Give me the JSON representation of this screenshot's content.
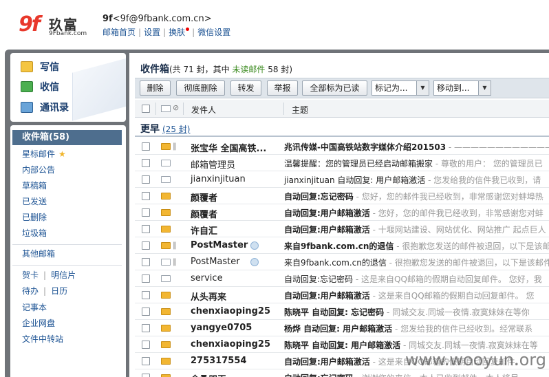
{
  "header": {
    "logo_mark": "9f",
    "logo_cn": "玖富",
    "logo_domain": "9Fbank.com",
    "user_name": "9f",
    "user_email": "<9f@9fbank.com.cn>",
    "links": [
      "邮箱首页",
      "设置",
      "换肤",
      "微信设置"
    ]
  },
  "actions": {
    "write": "写信",
    "receive": "收信",
    "contacts": "通讯录"
  },
  "sidebar": {
    "inbox": "收件箱(58)",
    "starred": "星标邮件",
    "items": [
      "内部公告",
      "草稿箱",
      "已发送",
      "已删除",
      "垃圾箱"
    ],
    "other": "其他邮箱",
    "card": "贺卡",
    "postcard": "明信片",
    "todo": "待办",
    "calendar": "日历",
    "notes": "记事本",
    "disk": "企业网盘",
    "transfer": "文件中转站"
  },
  "main": {
    "title": "收件箱",
    "summary_prefix": "(共 71 封，其中 ",
    "unread_label": "未读邮件",
    "summary_suffix": " 58 封)",
    "toolbar": {
      "delete": "删除",
      "purge": "彻底删除",
      "forward": "转发",
      "report": "举报",
      "mark_all_read": "全部标为已读",
      "mark_as": "标记为...",
      "move_to": "移动到..."
    },
    "columns": {
      "sender": "发件人",
      "subject": "主题"
    },
    "group": {
      "label": "更早",
      "count": "(25 封)"
    },
    "rows": [
      {
        "sender": "张宝华 全国高铁...",
        "subject": "兆讯传媒-中国高铁站数字媒体介绍201503",
        "preview": " - ———————————— 全面",
        "unread": true,
        "clip": true,
        "badge": false
      },
      {
        "sender": "邮箱管理员",
        "subject": "温馨提醒：您的管理员已经启动邮箱搬家",
        "preview": " - 尊敬的用户：   您的管理员已",
        "unread": false,
        "clip": false,
        "badge": false
      },
      {
        "sender": "jianxinjituan",
        "subject": "jianxinjituan 自动回复: 用户邮箱激活",
        "preview": " - 您发给我的信件我已收到，请",
        "unread": false,
        "clip": false,
        "badge": false
      },
      {
        "sender": "颜覆者",
        "subject": "自动回复:忘记密码",
        "preview": " - 您好，您的邮件我已经收到，非常感谢您对蚌埠热",
        "unread": true,
        "clip": false,
        "badge": false
      },
      {
        "sender": "颜覆者",
        "subject": "自动回复:用户邮箱激活",
        "preview": " - 您好，您的邮件我已经收到，非常感谢您对蚌",
        "unread": true,
        "clip": false,
        "badge": false
      },
      {
        "sender": "许自汇",
        "subject": "自动回复:用户邮箱激活",
        "preview": " - 十堰网站建设、网站优化、网站推广 起点巨人",
        "unread": true,
        "clip": false,
        "badge": false
      },
      {
        "sender": "PostMaster",
        "subject": "来自9fbank.com.cn的退信",
        "preview": " - 很抱歉您发送的邮件被退回，以下是该邮",
        "unread": true,
        "clip": true,
        "badge": true
      },
      {
        "sender": "PostMaster",
        "subject": "来自9fbank.com.cn的退信",
        "preview": " - 很抱歉您发送的邮件被退回，以下是该邮件",
        "unread": false,
        "clip": true,
        "badge": true
      },
      {
        "sender": "service",
        "subject": "自动回复:忘记密码",
        "preview": " - 这是来自QQ邮箱的假期自动回复邮件。    您好，我",
        "unread": false,
        "clip": false,
        "badge": false
      },
      {
        "sender": "从头再来",
        "subject": "自动回复:用户邮箱激活",
        "preview": " - 这是来自QQ邮箱的假期自动回复邮件。    您",
        "unread": true,
        "clip": false,
        "badge": false
      },
      {
        "sender": "chenxiaoping25",
        "subject": "陈晓平 自动回复: 忘记密码",
        "preview": " - 同城交友.同城一夜情.寂寞妹妹在等你",
        "unread": true,
        "clip": false,
        "badge": false
      },
      {
        "sender": "yangye0705",
        "subject": "杨烨 自动回复: 用户邮箱激活",
        "preview": " - 您发给我的信件已经收到。经常联系",
        "unread": true,
        "clip": false,
        "badge": false
      },
      {
        "sender": "chenxiaoping25",
        "subject": "陈晓平 自动回复: 用户邮箱激活",
        "preview": " - 同城交友.同城一夜情.寂寞妹妹在等",
        "unread": true,
        "clip": false,
        "badge": false
      },
      {
        "sender": "275317554",
        "subject": "自动回复:用户邮箱激活",
        "preview": " - 这是来自QQ邮箱的假期自动回复邮件。",
        "unread": true,
        "clip": false,
        "badge": false
      },
      {
        "sender": "余桑朋玉",
        "subject": "自动回复:忘记密码",
        "preview": " - 谢谢您的来信，本人已收到邮件，本人将尽",
        "unread": true,
        "clip": false,
        "badge": false
      }
    ]
  },
  "watermark": "www.wooyun.org"
}
